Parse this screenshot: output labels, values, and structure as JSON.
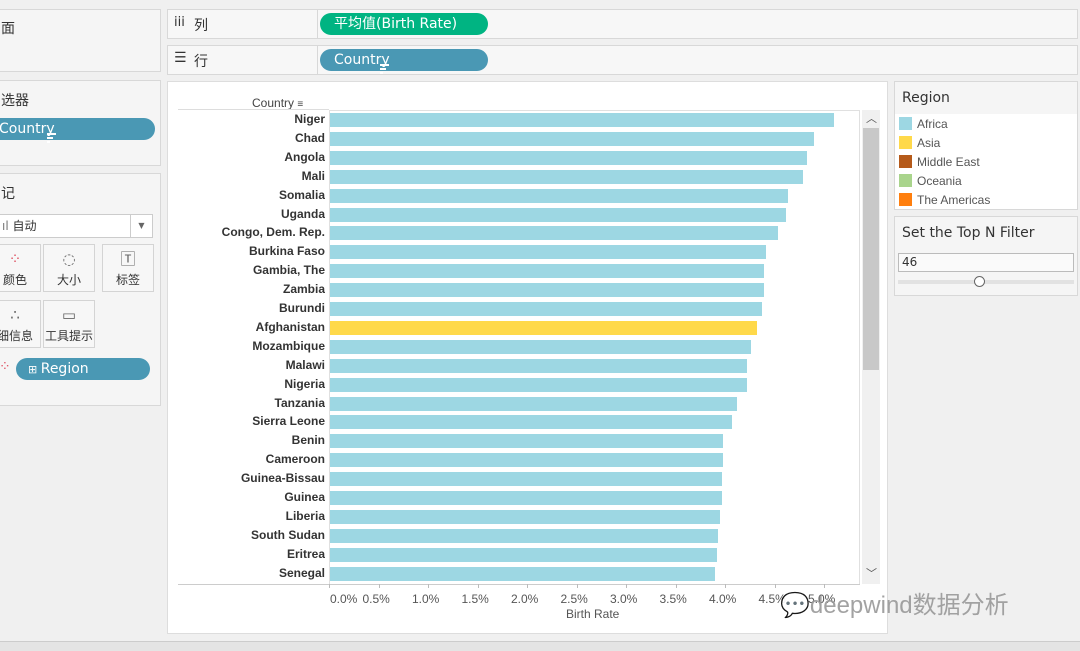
{
  "shelves": {
    "pages_label": "面",
    "columns_label": "列",
    "rows_label": "行",
    "columns_pill": "平均值(Birth Rate)",
    "rows_pill": "Country"
  },
  "filters": {
    "title": "选器",
    "pill": "Country"
  },
  "marks": {
    "title": "记",
    "mark_type": "自动",
    "cards": [
      {
        "label": "颜色",
        "icon": "color-dots-icon"
      },
      {
        "label": "大小",
        "icon": "size-icon"
      },
      {
        "label": "标签",
        "icon": "label-icon"
      },
      {
        "label": "细信息",
        "icon": "detail-icon"
      },
      {
        "label": "工具提示",
        "icon": "tooltip-icon"
      }
    ],
    "region_pill": "Region"
  },
  "colors": {
    "Africa": "#9dd7e3",
    "Asia": "#ffd94a",
    "Middle East": "#b55a1a",
    "Oceania": "#a9d48c",
    "The Americas": "#ff7f0e",
    "columns_pill": "#00b482",
    "rows_pill": "#4a98b4"
  },
  "legend": {
    "title": "Region",
    "items": [
      "Africa",
      "Asia",
      "Middle East",
      "Oceania",
      "The Americas"
    ]
  },
  "top_n": {
    "title": "Set the Top N Filter",
    "value": "46",
    "slider_fraction": 0.46
  },
  "watermark": "deepwind数据分析",
  "chart_data": {
    "type": "bar",
    "orientation": "horizontal",
    "row_header": "Country",
    "xlabel": "Birth Rate",
    "xlim": [
      0,
      0.053
    ],
    "xticks": [
      "0.0%",
      "0.5%",
      "1.0%",
      "1.5%",
      "2.0%",
      "2.5%",
      "3.0%",
      "3.5%",
      "4.0%",
      "4.5%",
      "5.0%"
    ],
    "categories": [
      "Niger",
      "Chad",
      "Angola",
      "Mali",
      "Somalia",
      "Uganda",
      "Congo, Dem. Rep.",
      "Burkina Faso",
      "Gambia, The",
      "Zambia",
      "Burundi",
      "Afghanistan",
      "Mozambique",
      "Malawi",
      "Nigeria",
      "Tanzania",
      "Sierra Leone",
      "Benin",
      "Cameroon",
      "Guinea-Bissau",
      "Guinea",
      "Liberia",
      "South Sudan",
      "Eritrea",
      "Senegal"
    ],
    "values": [
      0.0509,
      0.0489,
      0.0482,
      0.0478,
      0.0463,
      0.0461,
      0.0453,
      0.044,
      0.0438,
      0.0438,
      0.0436,
      0.0431,
      0.0425,
      0.0421,
      0.0421,
      0.0411,
      0.0406,
      0.0397,
      0.0397,
      0.0396,
      0.0396,
      0.0394,
      0.0392,
      0.0391,
      0.0389
    ],
    "regions": [
      "Africa",
      "Africa",
      "Africa",
      "Africa",
      "Africa",
      "Africa",
      "Africa",
      "Africa",
      "Africa",
      "Africa",
      "Africa",
      "Asia",
      "Africa",
      "Africa",
      "Africa",
      "Africa",
      "Africa",
      "Africa",
      "Africa",
      "Africa",
      "Africa",
      "Africa",
      "Africa",
      "Africa",
      "Africa"
    ]
  }
}
